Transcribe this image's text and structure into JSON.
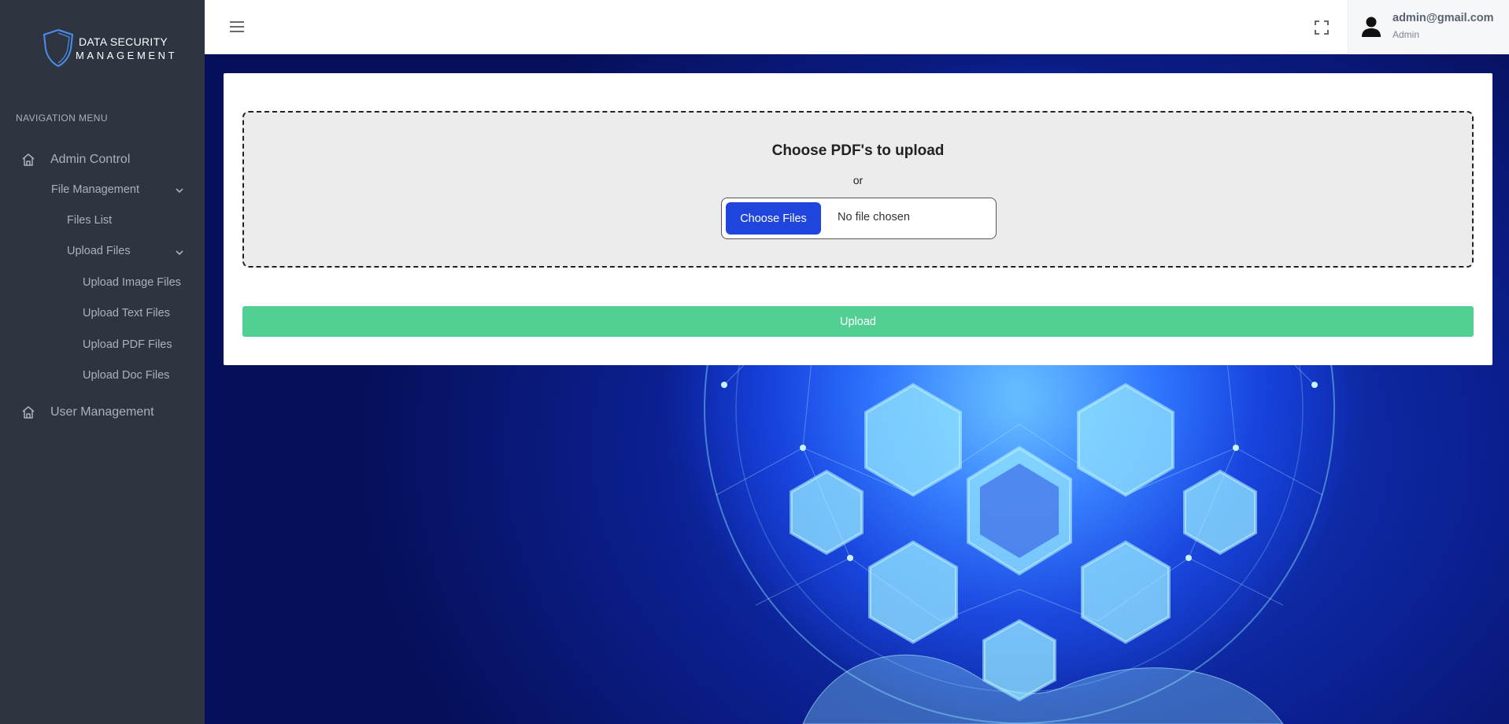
{
  "brand": {
    "line1": "DATA SECURITY",
    "line2": "MANAGEMENT",
    "icon": "shield-logo-icon"
  },
  "sidebar": {
    "header": "NAVIGATION MENU",
    "items": [
      {
        "label": "Admin Control",
        "icon": "home-icon"
      },
      {
        "label": "File Management",
        "icon": "chevron-down-icon"
      },
      {
        "label": "Files List"
      },
      {
        "label": "Upload Files",
        "icon": "chevron-down-icon"
      },
      {
        "label": "Upload Image Files"
      },
      {
        "label": "Upload Text Files"
      },
      {
        "label": "Upload PDF Files"
      },
      {
        "label": "Upload Doc Files"
      },
      {
        "label": "User Management",
        "icon": "home-icon"
      }
    ]
  },
  "topbar": {
    "menu_icon": "hamburger-icon",
    "fullscreen_icon": "fullscreen-icon",
    "user": {
      "email": "admin@gmail.com",
      "role": "Admin",
      "icon": "user-avatar-icon"
    }
  },
  "upload_card": {
    "title": "Choose PDF's to upload",
    "or_text": "or",
    "choose_button": "Choose Files",
    "file_status": "No file chosen",
    "submit_button": "Upload"
  },
  "colors": {
    "sidebar_bg": "#2f3540",
    "sidebar_text": "#a9b1bd",
    "choose_button": "#1f45dd",
    "upload_button": "#52cf93",
    "dropzone_bg": "#ececec"
  }
}
